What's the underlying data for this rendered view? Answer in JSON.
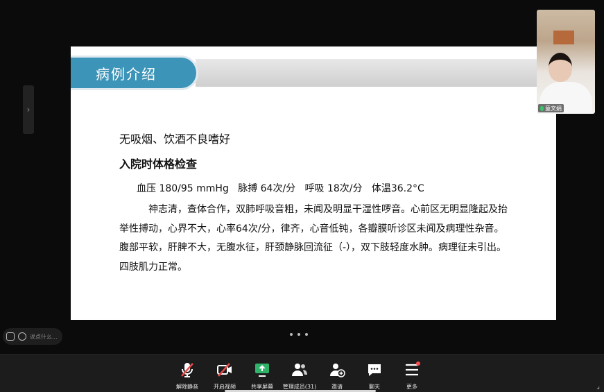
{
  "slide": {
    "title": "病例介绍",
    "line1": "无吸烟、饮酒不良嗜好",
    "line2": "入院时体格检查",
    "vitals": "血压 180/95 mmHg   脉搏 64次/分   呼吸 18次/分   体温36.2°C",
    "paragraph": "神志清，查体合作，双肺呼吸音粗，未闻及明显干湿性啰音。心前区无明显隆起及抬举性搏动，心界不大，心率64次/分，律齐，心音低钝，各瓣膜听诊区未闻及病理性杂音。腹部平软，肝脾不大，无腹水征，肝颈静脉回流征（-），双下肢轻度水肿。病理征未引出。四肢肌力正常。"
  },
  "participant": {
    "name": "童文娟"
  },
  "chat": {
    "placeholder": "说点什么..."
  },
  "toolbar": {
    "unmute": "解除静音",
    "start_video": "开启视频",
    "share_screen": "共享屏幕",
    "manage_members": "管理成员(31)",
    "invite": "邀请",
    "chat": "聊天",
    "more": "更多"
  },
  "colors": {
    "slide_accent": "#3c94b8",
    "share_green": "#2fb36a",
    "mute_red": "#e84a4a",
    "more_badge": "#ff4d4f"
  }
}
